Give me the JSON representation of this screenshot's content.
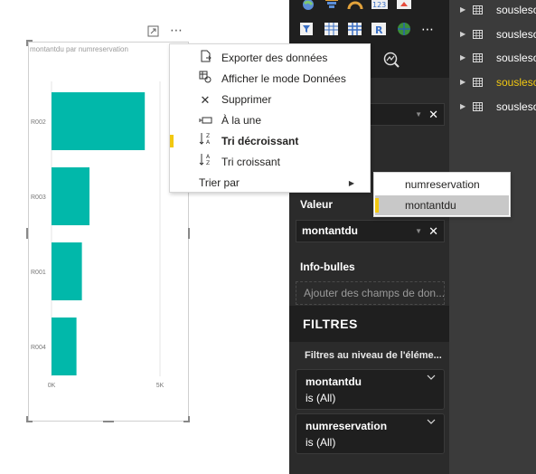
{
  "visual": {
    "header_icons": [
      "focus-mode-icon",
      "more-options-icon"
    ],
    "more_options_glyph": "⋯"
  },
  "chart_data": {
    "type": "bar",
    "orientation": "horizontal",
    "title": "montantdu par numreservation",
    "categories": [
      "R002",
      "R003",
      "R001",
      "R004"
    ],
    "values": [
      4300,
      1750,
      1400,
      1150
    ],
    "x_ticks": [
      {
        "value": 0,
        "label": "0K"
      },
      {
        "value": 5000,
        "label": "5K"
      }
    ],
    "xlim": [
      0,
      5000
    ],
    "bar_color": "#01b8aa",
    "grid": true
  },
  "context_menu": {
    "items": [
      {
        "label": "Exporter des données",
        "icon": "export-data-icon",
        "glyph": "🗎"
      },
      {
        "label": "Afficher le mode Données",
        "icon": "show-data-icon",
        "glyph": "▦"
      },
      {
        "label": "Supprimer",
        "icon": "delete-icon",
        "glyph": "✕"
      },
      {
        "label": "À la une",
        "icon": "spotlight-icon",
        "glyph": "⭘"
      },
      {
        "label": "Tri décroissant",
        "icon": "sort-descending-icon",
        "glyph": "↓",
        "active": true
      },
      {
        "label": "Tri croissant",
        "icon": "sort-ascending-icon",
        "glyph": "↓"
      },
      {
        "label": "Trier par",
        "icon": "",
        "glyph": ""
      }
    ],
    "submenu_arrow": "▶",
    "submenu": [
      {
        "label": "numreservation"
      },
      {
        "label": "montantdu",
        "selected": true
      }
    ]
  },
  "viz_pane": {
    "valeur_label": "Valeur",
    "valeur_field": "montantdu",
    "infobulles_label": "Info-bulles",
    "infobulles_placeholder": "Ajouter des champs de don...",
    "filtres_title": "FILTRES",
    "filter_level_title": "Filtres au niveau de l'éléme...",
    "filters": [
      {
        "name": "montantdu",
        "value": "is (All)"
      },
      {
        "name": "numreservation",
        "value": "is (All)"
      }
    ],
    "remove_glyph": "✕"
  },
  "fields_pane": {
    "tables": [
      {
        "label": "sousleso",
        "active": false
      },
      {
        "label": "sousleso",
        "active": false
      },
      {
        "label": "sousleso",
        "active": false
      },
      {
        "label": "sousleso",
        "active": true
      },
      {
        "label": "sousleso",
        "active": false
      }
    ]
  },
  "colors": {
    "accent": "#f2c811",
    "bar": "#01b8aa",
    "pane_dark": "#2b2b2b",
    "pane_darker": "#1f1f1f"
  }
}
